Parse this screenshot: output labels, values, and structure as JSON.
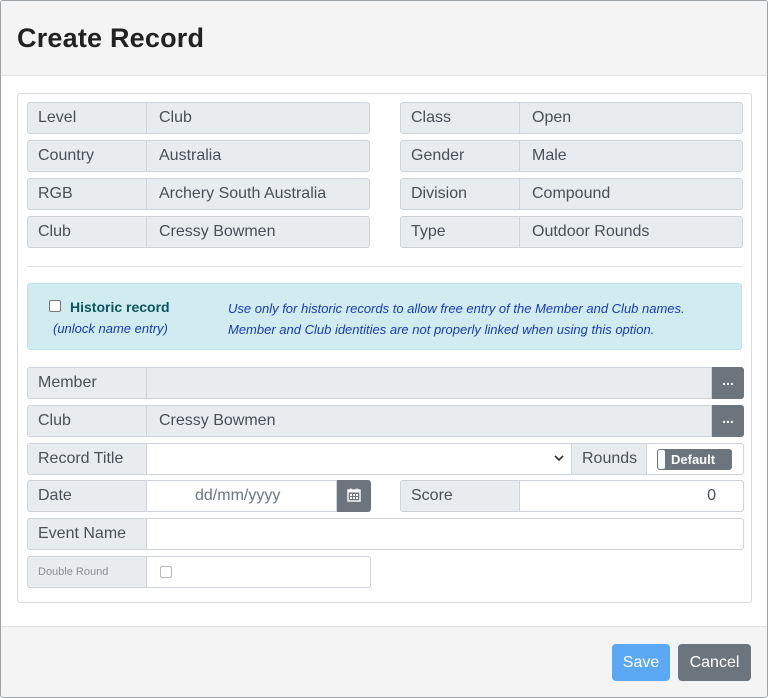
{
  "modal": {
    "title": "Create Record"
  },
  "details_left": [
    {
      "label": "Level",
      "value": "Club"
    },
    {
      "label": "Country",
      "value": "Australia"
    },
    {
      "label": "RGB",
      "value": "Archery South Australia"
    },
    {
      "label": "Club",
      "value": "Cressy Bowmen"
    }
  ],
  "details_right": [
    {
      "label": "Class",
      "value": "Open"
    },
    {
      "label": "Gender",
      "value": "Male"
    },
    {
      "label": "Division",
      "value": "Compound"
    },
    {
      "label": "Type",
      "value": "Outdoor Rounds"
    }
  ],
  "historic": {
    "checked": false,
    "label": "Historic record",
    "sublabel": "(unlock name entry)",
    "note_line1": "Use only for historic records to allow free entry of the Member and Club names.",
    "note_line2": "Member and Club identities are not properly linked when using this option."
  },
  "form": {
    "member_label": "Member",
    "member_value": "",
    "member_button": "...",
    "club_label": "Club",
    "club_value": "Cressy Bowmen",
    "club_button": "...",
    "record_title_label": "Record Title",
    "record_title_value": "",
    "rounds_label": "Rounds",
    "rounds_toggle": "Default",
    "date_label": "Date",
    "date_placeholder": "dd/mm/yyyy",
    "score_label": "Score",
    "score_value": "0",
    "event_name_label": "Event Name",
    "event_name_value": "",
    "double_round_label": "Double Round",
    "double_round_checked": false
  },
  "footer": {
    "save": "Save",
    "cancel": "Cancel"
  },
  "colors": {
    "primary_light": "#5ba8f5",
    "secondary": "#6c757d",
    "info_bg": "#d1ecf1",
    "info_text": "#1a39b8"
  }
}
